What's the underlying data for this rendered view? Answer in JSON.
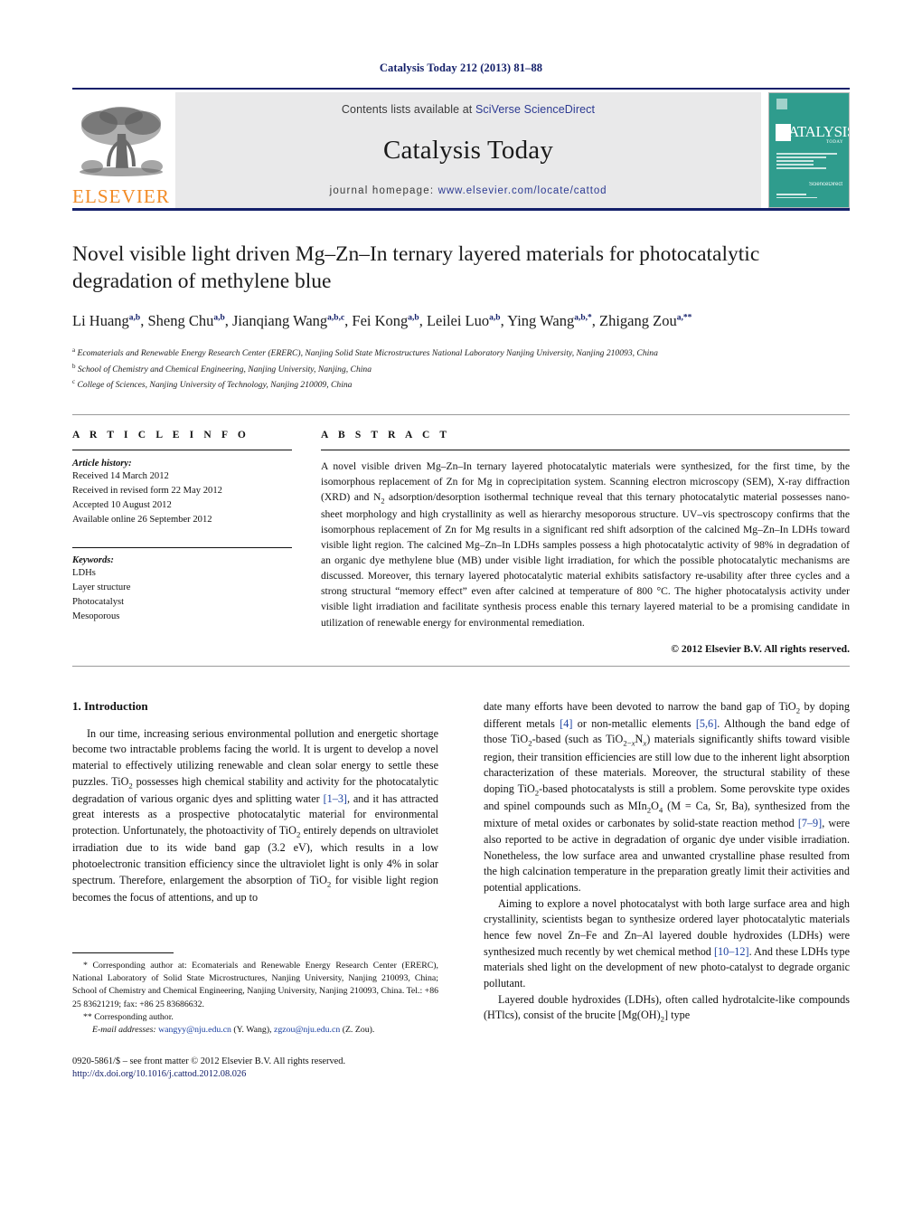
{
  "running_head": "Catalysis Today 212 (2013) 81–88",
  "masthead": {
    "publisher_logo_text": "ELSEVIER",
    "contents_prefix": "Contents lists available at ",
    "contents_link": "SciVerse ScienceDirect",
    "journal_title": "Catalysis Today",
    "homepage_prefix": "journal homepage: ",
    "homepage_url": "www.elsevier.com/locate/cattod",
    "cover_title": "CATALYSIS",
    "cover_subtitle": "TODAY",
    "cover_sciencedirect": "ScienceDirect",
    "accent_color": "#14206a",
    "link_color": "#2c3a92",
    "elsevier_orange": "#f28b26",
    "cover_teal": "#2f9c8d",
    "band_gray": "#e9e9ea"
  },
  "article": {
    "title": "Novel visible light driven Mg–Zn–In ternary layered materials for photocatalytic degradation of methylene blue",
    "authors": [
      {
        "name": "Li Huang",
        "sup": "a,b"
      },
      {
        "name": "Sheng Chu",
        "sup": "a,b"
      },
      {
        "name": "Jianqiang Wang",
        "sup": "a,b,c"
      },
      {
        "name": "Fei Kong",
        "sup": "a,b"
      },
      {
        "name": "Leilei Luo",
        "sup": "a,b"
      },
      {
        "name": "Ying Wang",
        "sup": "a,b,*"
      },
      {
        "name": "Zhigang Zou",
        "sup": "a,**"
      }
    ],
    "affiliations": [
      {
        "mark": "a",
        "text": "Ecomaterials and Renewable Energy Research Center (ERERC), Nanjing Solid State Microstructures National Laboratory Nanjing University, Nanjing 210093, China"
      },
      {
        "mark": "b",
        "text": "School of Chemistry and Chemical Engineering, Nanjing University, Nanjing, China"
      },
      {
        "mark": "c",
        "text": "College of Sciences, Nanjing University of Technology, Nanjing 210009, China"
      }
    ]
  },
  "article_info": {
    "heading": "A R T I C L E   I N F O",
    "history_label": "Article history:",
    "history": [
      "Received 14 March 2012",
      "Received in revised form 22 May 2012",
      "Accepted 10 August 2012",
      "Available online 26 September 2012"
    ],
    "keywords_label": "Keywords:",
    "keywords": [
      "LDHs",
      "Layer structure",
      "Photocatalyst",
      "Mesoporous"
    ]
  },
  "abstract": {
    "heading": "A B S T R A C T",
    "text": "A novel visible driven Mg–Zn–In ternary layered photocatalytic materials were synthesized, for the first time, by the isomorphous replacement of Zn for Mg in coprecipitation system. Scanning electron microscopy (SEM), X-ray diffraction (XRD) and N2 adsorption/desorption isothermal technique reveal that this ternary photocatalytic material possesses nano-sheet morphology and high crystallinity as well as hierarchy mesoporous structure. UV–vis spectroscopy confirms that the isomorphous replacement of Zn for Mg results in a significant red shift adsorption of the calcined Mg–Zn–In LDHs toward visible light region. The calcined Mg–Zn–In LDHs samples possess a high photocatalytic activity of 98% in degradation of an organic dye methylene blue (MB) under visible light irradiation, for which the possible photocatalytic mechanisms are discussed. Moreover, this ternary layered photocatalytic material exhibits satisfactory re-usability after three cycles and a strong structural “memory effect” even after calcined at temperature of 800 °C. The higher photocatalysis activity under visible light irradiation and facilitate synthesis process enable this ternary layered material to be a promising candidate in utilization of renewable energy for environmental remediation.",
    "copyright": "© 2012 Elsevier B.V. All rights reserved."
  },
  "body": {
    "section_number_title": "1.  Introduction",
    "left_para_1": "In our time, increasing serious environmental pollution and energetic shortage become two intractable problems facing the world. It is urgent to develop a novel material to effectively utilizing renewable and clean solar energy to settle these puzzles. TiO2 possesses high chemical stability and activity for the photocatalytic degradation of various organic dyes and splitting water [1–3], and it has attracted great interests as a prospective photocatalytic material for environmental protection. Unfortunately, the photoactivity of TiO2 entirely depends on ultraviolet irradiation due to its wide band gap (3.2 eV), which results in a low photoelectronic transition efficiency since the ultraviolet light is only 4% in solar spectrum. Therefore, enlargement the absorption of TiO2 for visible light region becomes the focus of attentions, and up to",
    "right_para_1": "date many efforts have been devoted to narrow the band gap of TiO2 by doping different metals [4] or non-metallic elements [5,6]. Although the band edge of those TiO2-based (such as TiO2−xNx) materials significantly shifts toward visible region, their transition efficiencies are still low due to the inherent light absorption characterization of these materials. Moreover, the structural stability of these doping TiO2-based photocatalysts is still a problem. Some perovskite type oxides and spinel compounds such as MIn2O4 (M = Ca, Sr, Ba), synthesized from the mixture of metal oxides or carbonates by solid-state reaction method [7–9], were also reported to be active in degradation of organic dye under visible irradiation. Nonetheless, the low surface area and unwanted crystalline phase resulted from the high calcination temperature in the preparation greatly limit their activities and potential applications.",
    "right_para_2": "Aiming to explore a novel photocatalyst with both large surface area and high crystallinity, scientists began to synthesize ordered layer photocatalytic materials hence few novel Zn–Fe and Zn–Al layered double hydroxides (LDHs) were synthesized much recently by wet chemical method [10–12]. And these LDHs type materials shed light on the development of new photo-catalyst to degrade organic pollutant.",
    "right_para_3": "Layered double hydroxides (LDHs), often called hydrotalcite-like compounds (HTlcs), consist of the brucite [Mg(OH)2] type"
  },
  "footnotes": {
    "star_note": "* Corresponding author at: Ecomaterials and Renewable Energy Research Center (ERERC), National Laboratory of Solid State Microstructures, Nanjing University, Nanjing 210093, China; School of Chemistry and Chemical Engineering, Nanjing University, Nanjing 210093, China. Tel.: +86 25 83621219; fax: +86 25 83686632.",
    "dstar_note": "** Corresponding author.",
    "email_label": "E-mail addresses:",
    "email_1": "wangyy@nju.edu.cn",
    "email_1_owner": "(Y. Wang),",
    "email_2": "zgzou@nju.edu.cn",
    "email_2_owner": "(Z. Zou).",
    "issn_line": "0920-5861/$ – see front matter © 2012 Elsevier B.V. All rights reserved.",
    "doi_line": "http://dx.doi.org/10.1016/j.cattod.2012.08.026"
  }
}
